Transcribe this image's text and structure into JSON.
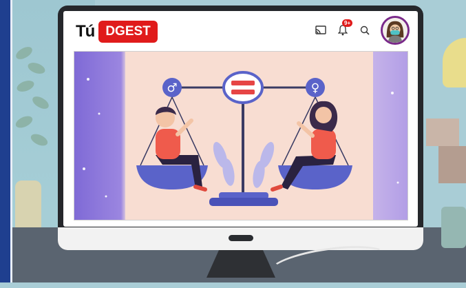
{
  "app": {
    "logo_text": "Tú",
    "logo_badge": "DGEST",
    "notification_count": "9+"
  },
  "icons": [
    "cast-icon",
    "bell-icon",
    "search-icon",
    "avatar"
  ],
  "colors": {
    "brand_red": "#e01b1b",
    "avatar_ring": "#7a2a8a",
    "scale_blue": "#5a63c9",
    "background": "#a9cdd6"
  },
  "illustration": {
    "male_symbol": "♂",
    "female_symbol": "♀",
    "equal_symbol": "="
  }
}
